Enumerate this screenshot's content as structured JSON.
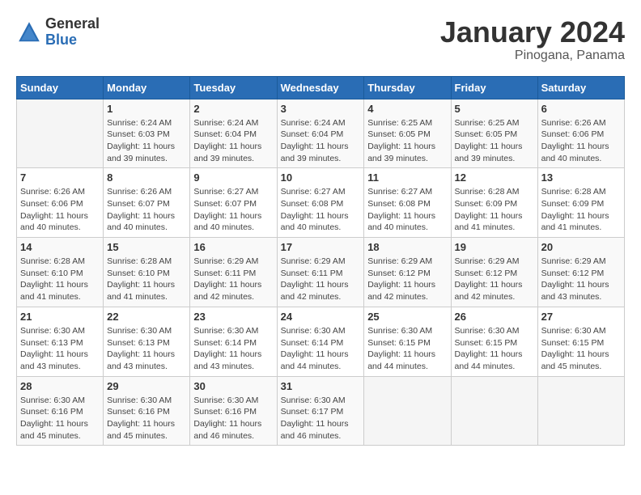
{
  "header": {
    "logo_general": "General",
    "logo_blue": "Blue",
    "month_title": "January 2024",
    "subtitle": "Pinogana, Panama"
  },
  "days_of_week": [
    "Sunday",
    "Monday",
    "Tuesday",
    "Wednesday",
    "Thursday",
    "Friday",
    "Saturday"
  ],
  "weeks": [
    [
      {
        "day": "",
        "sunrise": "",
        "sunset": "",
        "daylight": ""
      },
      {
        "day": "1",
        "sunrise": "Sunrise: 6:24 AM",
        "sunset": "Sunset: 6:03 PM",
        "daylight": "Daylight: 11 hours and 39 minutes."
      },
      {
        "day": "2",
        "sunrise": "Sunrise: 6:24 AM",
        "sunset": "Sunset: 6:04 PM",
        "daylight": "Daylight: 11 hours and 39 minutes."
      },
      {
        "day": "3",
        "sunrise": "Sunrise: 6:24 AM",
        "sunset": "Sunset: 6:04 PM",
        "daylight": "Daylight: 11 hours and 39 minutes."
      },
      {
        "day": "4",
        "sunrise": "Sunrise: 6:25 AM",
        "sunset": "Sunset: 6:05 PM",
        "daylight": "Daylight: 11 hours and 39 minutes."
      },
      {
        "day": "5",
        "sunrise": "Sunrise: 6:25 AM",
        "sunset": "Sunset: 6:05 PM",
        "daylight": "Daylight: 11 hours and 39 minutes."
      },
      {
        "day": "6",
        "sunrise": "Sunrise: 6:26 AM",
        "sunset": "Sunset: 6:06 PM",
        "daylight": "Daylight: 11 hours and 40 minutes."
      }
    ],
    [
      {
        "day": "7",
        "sunrise": "Sunrise: 6:26 AM",
        "sunset": "Sunset: 6:06 PM",
        "daylight": "Daylight: 11 hours and 40 minutes."
      },
      {
        "day": "8",
        "sunrise": "Sunrise: 6:26 AM",
        "sunset": "Sunset: 6:07 PM",
        "daylight": "Daylight: 11 hours and 40 minutes."
      },
      {
        "day": "9",
        "sunrise": "Sunrise: 6:27 AM",
        "sunset": "Sunset: 6:07 PM",
        "daylight": "Daylight: 11 hours and 40 minutes."
      },
      {
        "day": "10",
        "sunrise": "Sunrise: 6:27 AM",
        "sunset": "Sunset: 6:08 PM",
        "daylight": "Daylight: 11 hours and 40 minutes."
      },
      {
        "day": "11",
        "sunrise": "Sunrise: 6:27 AM",
        "sunset": "Sunset: 6:08 PM",
        "daylight": "Daylight: 11 hours and 40 minutes."
      },
      {
        "day": "12",
        "sunrise": "Sunrise: 6:28 AM",
        "sunset": "Sunset: 6:09 PM",
        "daylight": "Daylight: 11 hours and 41 minutes."
      },
      {
        "day": "13",
        "sunrise": "Sunrise: 6:28 AM",
        "sunset": "Sunset: 6:09 PM",
        "daylight": "Daylight: 11 hours and 41 minutes."
      }
    ],
    [
      {
        "day": "14",
        "sunrise": "Sunrise: 6:28 AM",
        "sunset": "Sunset: 6:10 PM",
        "daylight": "Daylight: 11 hours and 41 minutes."
      },
      {
        "day": "15",
        "sunrise": "Sunrise: 6:28 AM",
        "sunset": "Sunset: 6:10 PM",
        "daylight": "Daylight: 11 hours and 41 minutes."
      },
      {
        "day": "16",
        "sunrise": "Sunrise: 6:29 AM",
        "sunset": "Sunset: 6:11 PM",
        "daylight": "Daylight: 11 hours and 42 minutes."
      },
      {
        "day": "17",
        "sunrise": "Sunrise: 6:29 AM",
        "sunset": "Sunset: 6:11 PM",
        "daylight": "Daylight: 11 hours and 42 minutes."
      },
      {
        "day": "18",
        "sunrise": "Sunrise: 6:29 AM",
        "sunset": "Sunset: 6:12 PM",
        "daylight": "Daylight: 11 hours and 42 minutes."
      },
      {
        "day": "19",
        "sunrise": "Sunrise: 6:29 AM",
        "sunset": "Sunset: 6:12 PM",
        "daylight": "Daylight: 11 hours and 42 minutes."
      },
      {
        "day": "20",
        "sunrise": "Sunrise: 6:29 AM",
        "sunset": "Sunset: 6:12 PM",
        "daylight": "Daylight: 11 hours and 43 minutes."
      }
    ],
    [
      {
        "day": "21",
        "sunrise": "Sunrise: 6:30 AM",
        "sunset": "Sunset: 6:13 PM",
        "daylight": "Daylight: 11 hours and 43 minutes."
      },
      {
        "day": "22",
        "sunrise": "Sunrise: 6:30 AM",
        "sunset": "Sunset: 6:13 PM",
        "daylight": "Daylight: 11 hours and 43 minutes."
      },
      {
        "day": "23",
        "sunrise": "Sunrise: 6:30 AM",
        "sunset": "Sunset: 6:14 PM",
        "daylight": "Daylight: 11 hours and 43 minutes."
      },
      {
        "day": "24",
        "sunrise": "Sunrise: 6:30 AM",
        "sunset": "Sunset: 6:14 PM",
        "daylight": "Daylight: 11 hours and 44 minutes."
      },
      {
        "day": "25",
        "sunrise": "Sunrise: 6:30 AM",
        "sunset": "Sunset: 6:15 PM",
        "daylight": "Daylight: 11 hours and 44 minutes."
      },
      {
        "day": "26",
        "sunrise": "Sunrise: 6:30 AM",
        "sunset": "Sunset: 6:15 PM",
        "daylight": "Daylight: 11 hours and 44 minutes."
      },
      {
        "day": "27",
        "sunrise": "Sunrise: 6:30 AM",
        "sunset": "Sunset: 6:15 PM",
        "daylight": "Daylight: 11 hours and 45 minutes."
      }
    ],
    [
      {
        "day": "28",
        "sunrise": "Sunrise: 6:30 AM",
        "sunset": "Sunset: 6:16 PM",
        "daylight": "Daylight: 11 hours and 45 minutes."
      },
      {
        "day": "29",
        "sunrise": "Sunrise: 6:30 AM",
        "sunset": "Sunset: 6:16 PM",
        "daylight": "Daylight: 11 hours and 45 minutes."
      },
      {
        "day": "30",
        "sunrise": "Sunrise: 6:30 AM",
        "sunset": "Sunset: 6:16 PM",
        "daylight": "Daylight: 11 hours and 46 minutes."
      },
      {
        "day": "31",
        "sunrise": "Sunrise: 6:30 AM",
        "sunset": "Sunset: 6:17 PM",
        "daylight": "Daylight: 11 hours and 46 minutes."
      },
      {
        "day": "",
        "sunrise": "",
        "sunset": "",
        "daylight": ""
      },
      {
        "day": "",
        "sunrise": "",
        "sunset": "",
        "daylight": ""
      },
      {
        "day": "",
        "sunrise": "",
        "sunset": "",
        "daylight": ""
      }
    ]
  ]
}
